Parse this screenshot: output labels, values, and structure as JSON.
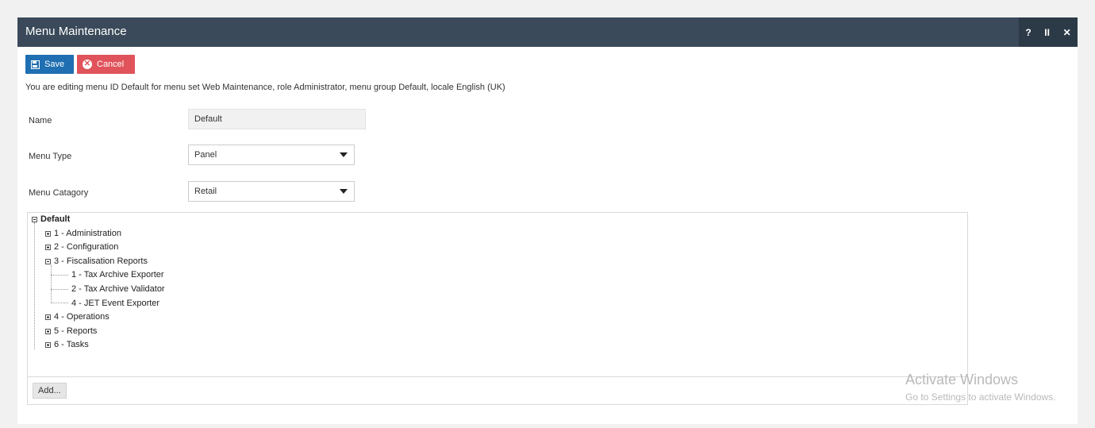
{
  "window": {
    "title": "Menu Maintenance",
    "controls": [
      "?",
      "II",
      "✕"
    ]
  },
  "toolbar": {
    "save_label": "Save",
    "cancel_label": "Cancel"
  },
  "info_text": "You are editing menu ID Default for menu set Web Maintenance, role Administrator, menu group Default, locale English (UK)",
  "form": {
    "name_label": "Name",
    "name_value": "Default",
    "menu_type_label": "Menu Type",
    "menu_type_value": "Panel",
    "menu_category_label": "Menu Catagory",
    "menu_category_value": "Retail"
  },
  "tree": {
    "root": "Default",
    "items": [
      {
        "label": "1 - Administration",
        "expanded": false
      },
      {
        "label": "2 - Configuration",
        "expanded": false
      },
      {
        "label": "3 - Fiscalisation Reports",
        "expanded": true,
        "children": [
          "1 - Tax Archive Exporter",
          "2 - Tax Archive Validator",
          "4 - JET Event Exporter"
        ]
      },
      {
        "label": "4 - Operations",
        "expanded": false
      },
      {
        "label": "5 - Reports",
        "expanded": false
      },
      {
        "label": "6 - Tasks",
        "expanded": false
      }
    ],
    "add_label": "Add..."
  },
  "watermark": {
    "line1": "Activate Windows",
    "line2": "Go to Settings to activate Windows."
  },
  "colors": {
    "titlebar": "#3a4a5a",
    "save": "#1f6fb2",
    "cancel": "#e0535a"
  }
}
